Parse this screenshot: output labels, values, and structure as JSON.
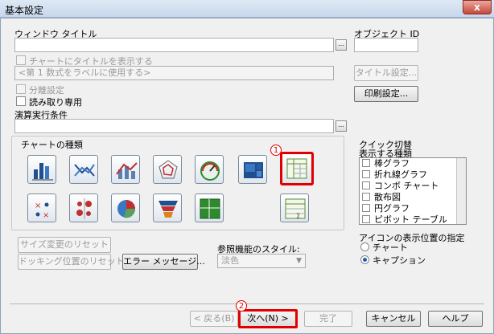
{
  "window": {
    "title": "基本設定",
    "close": "x"
  },
  "fields": {
    "window_title_label": "ウィンドウ タイトル",
    "object_id_label": "オブジェクト ID",
    "show_title_label": "チャートにタイトルを表示する",
    "title_placeholder": "<第 1 数式をラベルに使用する>",
    "title_settings_button": "タイトル設定...",
    "subgroup_label": "分離設定",
    "read_only_label": "読み取り専用",
    "print_settings_button": "印刷設定...",
    "calc_condition_label": "演算実行条件",
    "ellipsis": "..."
  },
  "chart_types": {
    "label": "チャートの種類",
    "row1": [
      "bar-chart-icon",
      "line-chart-icon",
      "combo-chart-icon",
      "radar-chart-icon",
      "gauge-chart-icon",
      "block-chart-icon",
      "pivot-table-icon"
    ],
    "row2": [
      "scatter-chart-icon",
      "grid-chart-icon",
      "pie-chart-icon",
      "funnel-chart-icon",
      "mekko-chart-icon",
      "straight-table-icon"
    ]
  },
  "quick": {
    "label": "クイック切替",
    "list_label": "表示する種類",
    "items": [
      "棒グラフ",
      "折れ線グラフ",
      "コンボ チャート",
      "散布図",
      "円グラフ",
      "ピボット テーブル"
    ],
    "icon_position_label": "アイコンの表示位置の指定",
    "radio_chart": "チャート",
    "radio_caption": "キャプション"
  },
  "buttons": {
    "reset_size": "サイズ変更のリセット",
    "reset_docking": "ドッキング位置のリセット",
    "error_message": "エラー メッセージ...",
    "back": "< 戻る(B)",
    "next": "次へ(N) >",
    "finish": "完了",
    "cancel": "キャンセル",
    "help": "ヘルプ"
  },
  "style": {
    "label": "参照機能のスタイル:",
    "value": "淡色"
  },
  "annotations": {
    "one": "1",
    "two": "2"
  },
  "colors": {
    "highlight": "#e00000"
  }
}
